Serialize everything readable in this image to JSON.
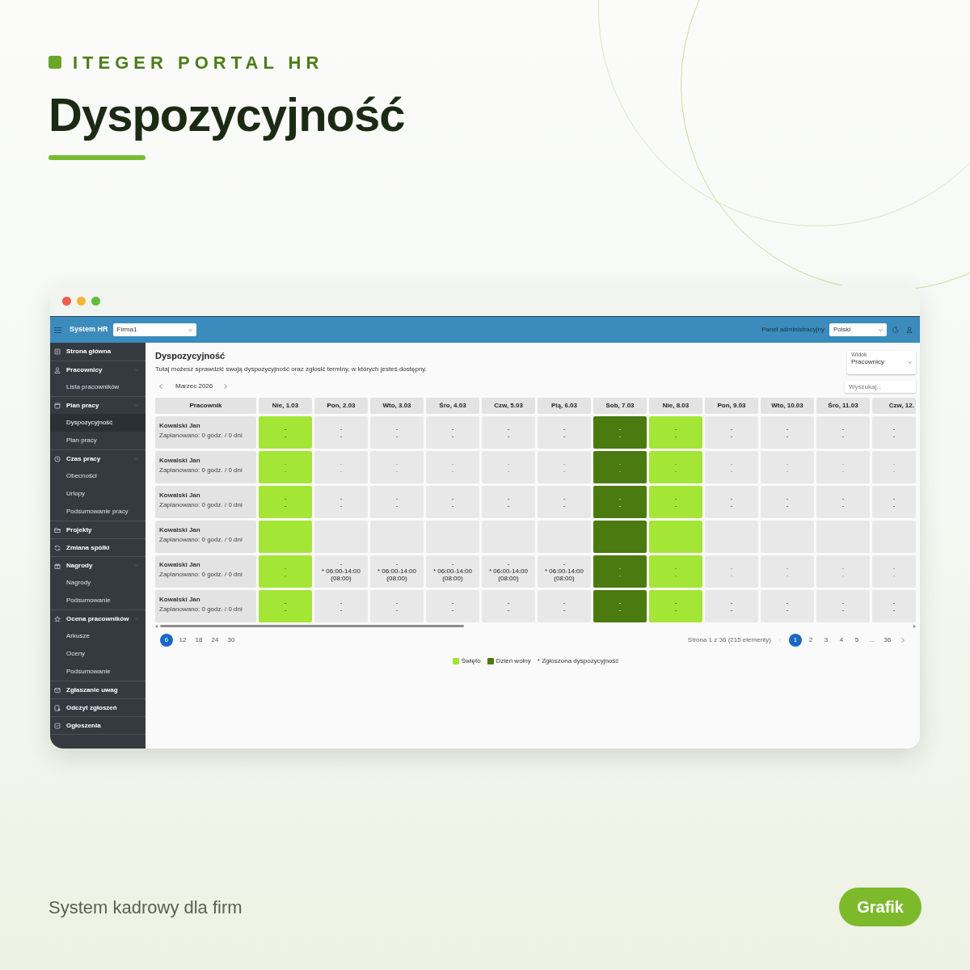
{
  "brand": "ITEGER PORTAL HR",
  "headline": "Dyspozycyjność",
  "window": {
    "header": {
      "app_name": "System HR",
      "company_select": "Firma1",
      "admin_link": "Panel administracyjny",
      "language_select": "Polski"
    },
    "sidebar": [
      {
        "label": "Strona główna"
      },
      {
        "label": "Pracownicy",
        "expanded": true,
        "children": [
          {
            "label": "Lista pracowników",
            "selected": false
          }
        ]
      },
      {
        "label": "Plan pracy",
        "expanded": true,
        "children": [
          {
            "label": "Dyspozycyjność",
            "selected": true
          },
          {
            "label": "Plan pracy",
            "selected": false
          }
        ]
      },
      {
        "label": "Czas pracy",
        "expanded": true,
        "children": [
          {
            "label": "Obecności",
            "selected": false
          },
          {
            "label": "Urlopy",
            "selected": false
          },
          {
            "label": "Podsumowanie pracy",
            "selected": false
          }
        ]
      },
      {
        "label": "Projekty"
      },
      {
        "label": "Zmiana spółki"
      },
      {
        "label": "Nagrody",
        "expanded": true,
        "children": [
          {
            "label": "Nagrody",
            "selected": false
          },
          {
            "label": "Podsumowanie",
            "selected": false
          }
        ]
      },
      {
        "label": "Ocena pracowników",
        "expanded": true,
        "children": [
          {
            "label": "Arkusze",
            "selected": false
          },
          {
            "label": "Oceny",
            "selected": false
          },
          {
            "label": "Podsumowanie",
            "selected": false
          }
        ]
      },
      {
        "label": "Zgłaszanie uwag"
      },
      {
        "label": "Odczyt zgłoszeń"
      },
      {
        "label": "Ogłoszenia"
      }
    ],
    "page_title": "Dyspozycyjność",
    "description": "Tutaj możesz sprawdzić swoją dyspozycyjność oraz zgłosić terminy, w których jesteś dostępny.",
    "view_select": {
      "label": "Widok",
      "value": "Pracownicy"
    },
    "month": "Marzec 2026",
    "search": {
      "placeholder": "Wyszukaj..."
    },
    "table": {
      "employee_header": "Pracownik",
      "columns": [
        {
          "label": "Nie, 1.03",
          "kind": "holiday"
        },
        {
          "label": "Pon, 2.03",
          "kind": "normal"
        },
        {
          "label": "Wto, 3.03",
          "kind": "normal"
        },
        {
          "label": "Śro, 4.03",
          "kind": "normal"
        },
        {
          "label": "Czw, 5.03",
          "kind": "normal"
        },
        {
          "label": "Pią, 6.03",
          "kind": "normal"
        },
        {
          "label": "Sob, 7.03",
          "kind": "off"
        },
        {
          "label": "Nie, 8.03",
          "kind": "holiday"
        },
        {
          "label": "Pon, 9.03",
          "kind": "normal"
        },
        {
          "label": "Wto, 10.03",
          "kind": "normal"
        },
        {
          "label": "Śro, 11.03",
          "kind": "normal"
        },
        {
          "label": "Czw, 12.",
          "kind": "normal"
        }
      ],
      "rows": [
        {
          "name": "Kowalski Jan",
          "summary": "Zaplanowano: 0 godz. / 0 dni",
          "cells": [
            {
              "lines": [
                "-",
                "-"
              ],
              "faint": false
            },
            {
              "lines": [
                "-",
                "-"
              ],
              "faint": false
            },
            {
              "lines": [
                "-",
                "-"
              ],
              "faint": false
            },
            {
              "lines": [
                "-",
                "-"
              ],
              "faint": false
            },
            {
              "lines": [
                "-",
                "-"
              ],
              "faint": false
            },
            {
              "lines": [
                "-",
                "-"
              ],
              "faint": false
            },
            {
              "lines": [
                "-",
                "-"
              ],
              "faint": false
            },
            {
              "lines": [
                "-",
                "-"
              ],
              "faint": false
            },
            {
              "lines": [
                "-",
                "-"
              ],
              "faint": false
            },
            {
              "lines": [
                "-",
                "-"
              ],
              "faint": false
            },
            {
              "lines": [
                "-",
                "-"
              ],
              "faint": false
            },
            {
              "lines": [
                "-",
                "-"
              ],
              "faint": false
            }
          ]
        },
        {
          "name": "Kowalski Jan",
          "summary": "Zaplanowano: 0 godz. / 0 dni",
          "cells": [
            {
              "lines": [
                "-",
                "-"
              ],
              "faint": true
            },
            {
              "lines": [
                "-",
                "-"
              ],
              "faint": true
            },
            {
              "lines": [
                "-",
                "-"
              ],
              "faint": true
            },
            {
              "lines": [
                "-",
                "-"
              ],
              "faint": true
            },
            {
              "lines": [
                "-",
                "-"
              ],
              "faint": true
            },
            {
              "lines": [
                "-",
                "-"
              ],
              "faint": true
            },
            {
              "lines": [
                "-",
                "-"
              ],
              "faint": true
            },
            {
              "lines": [
                "-",
                "-"
              ],
              "faint": true
            },
            {
              "lines": [
                "-",
                "-"
              ],
              "faint": true
            },
            {
              "lines": [
                "-",
                "-"
              ],
              "faint": true
            },
            {
              "lines": [
                "-",
                "-"
              ],
              "faint": true
            },
            {
              "lines": [
                "-",
                "-"
              ],
              "faint": true
            }
          ]
        },
        {
          "name": "Kowalski Jan",
          "summary": "Zaplanowano: 0 godz. / 0 dni",
          "cells": [
            {
              "lines": [
                "-",
                "-"
              ],
              "faint": false
            },
            {
              "lines": [
                "-",
                "-"
              ],
              "faint": false
            },
            {
              "lines": [
                "-",
                "-"
              ],
              "faint": false
            },
            {
              "lines": [
                "-",
                "-"
              ],
              "faint": false
            },
            {
              "lines": [
                "-",
                "-"
              ],
              "faint": false
            },
            {
              "lines": [
                "-",
                "-"
              ],
              "faint": false
            },
            {
              "lines": [
                "-",
                "-"
              ],
              "faint": false
            },
            {
              "lines": [
                "-",
                "-"
              ],
              "faint": false
            },
            {
              "lines": [
                "-",
                "-"
              ],
              "faint": false
            },
            {
              "lines": [
                "-",
                "-"
              ],
              "faint": false
            },
            {
              "lines": [
                "-",
                "-"
              ],
              "faint": false
            },
            {
              "lines": [
                "-",
                "-"
              ],
              "faint": false
            }
          ]
        },
        {
          "name": "Kowalski Jan",
          "summary": "Zaplanowano: 0 godz. / 0 dni"
        },
        {
          "name": "Kowalski Jan",
          "summary": "Zaplanowano: 0 godz. / 0 dni",
          "cells": [
            {
              "lines": [
                "-",
                "-"
              ],
              "faint": true
            },
            {
              "lines": [
                "-",
                "* 06:00-14:00 (08:00)"
              ],
              "faint": false
            },
            {
              "lines": [
                "-",
                "* 06:00-14:00 (08:00)"
              ],
              "faint": false
            },
            {
              "lines": [
                "-",
                "* 06:00-14:00 (08:00)"
              ],
              "faint": false
            },
            {
              "lines": [
                "-",
                "* 06:00-14:00 (08:00)"
              ],
              "faint": false
            },
            {
              "lines": [
                "-",
                "* 06:00-14:00 (08:00)"
              ],
              "faint": false
            },
            {
              "lines": [
                "-",
                "-"
              ],
              "faint": true
            },
            {
              "lines": [
                "-",
                "-"
              ],
              "faint": true
            },
            {
              "lines": [
                "-",
                "-"
              ],
              "faint": true
            },
            {
              "lines": [
                "-",
                "-"
              ],
              "faint": true
            },
            {
              "lines": [
                "-",
                "-"
              ],
              "faint": true
            },
            {
              "lines": [
                "-",
                "-"
              ],
              "faint": true
            }
          ]
        },
        {
          "name": "Kowalski Jan",
          "summary": "Zaplanowano: 0 godz. / 0 dni",
          "cells": [
            {
              "lines": [
                "-",
                "-"
              ],
              "faint": false
            },
            {
              "lines": [
                "-",
                "-"
              ],
              "faint": false
            },
            {
              "lines": [
                "-",
                "-"
              ],
              "faint": false
            },
            {
              "lines": [
                "-",
                "-"
              ],
              "faint": false
            },
            {
              "lines": [
                "-",
                "-"
              ],
              "faint": false
            },
            {
              "lines": [
                "-",
                "-"
              ],
              "faint": false
            },
            {
              "lines": [
                "-",
                "-"
              ],
              "faint": false
            },
            {
              "lines": [
                "-",
                "-"
              ],
              "faint": false
            },
            {
              "lines": [
                "-",
                "-"
              ],
              "faint": false
            },
            {
              "lines": [
                "-",
                "-"
              ],
              "faint": false
            },
            {
              "lines": [
                "-",
                "-"
              ],
              "faint": false
            },
            {
              "lines": [
                "-",
                "-"
              ],
              "faint": false
            }
          ]
        }
      ]
    },
    "page_sizes": [
      {
        "label": "6",
        "selected": true
      },
      {
        "label": "12",
        "selected": false
      },
      {
        "label": "18",
        "selected": false
      },
      {
        "label": "24",
        "selected": false
      },
      {
        "label": "30",
        "selected": false
      }
    ],
    "pagination": {
      "summary": "Strona 1 z 36 (215 elementy)",
      "prev_disabled": true,
      "pages": [
        {
          "label": "1",
          "selected": true
        },
        {
          "label": "2",
          "selected": false
        },
        {
          "label": "3",
          "selected": false
        },
        {
          "label": "4",
          "selected": false
        },
        {
          "label": "5",
          "selected": false
        },
        {
          "label": "...",
          "selected": false
        },
        {
          "label": "36",
          "selected": false
        }
      ]
    },
    "legend": [
      {
        "kind": "holiday",
        "label": "Święto"
      },
      {
        "kind": "off",
        "label": "Dzień wolny"
      },
      {
        "kind": "note",
        "label": "* Zgłoszona dyspozycyjność"
      }
    ]
  },
  "tagline": "System kadrowy dla firm",
  "badge": "Grafik"
}
